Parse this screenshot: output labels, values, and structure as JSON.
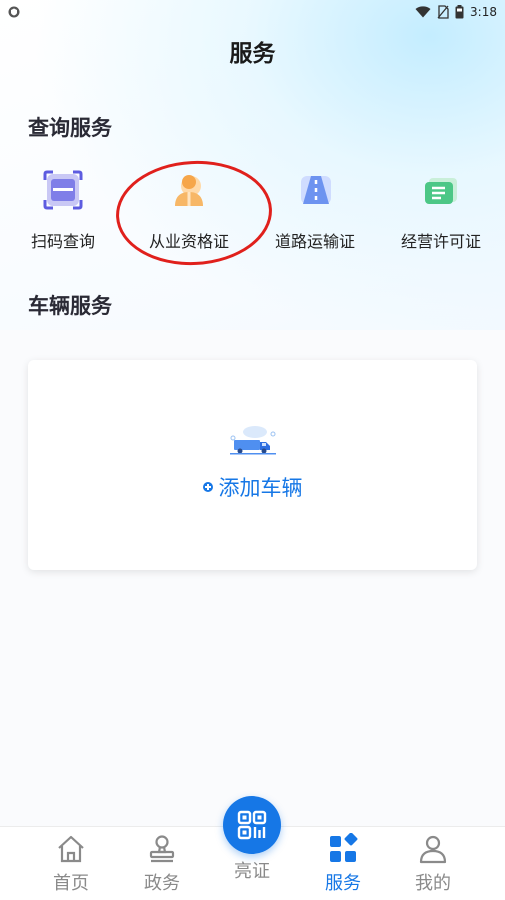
{
  "status_bar": {
    "time": "3:18",
    "icons": [
      "app-shield-icon",
      "wifi-icon",
      "no-sim-icon",
      "battery-icon"
    ]
  },
  "page_title": "服务",
  "query_section": {
    "title": "查询服务",
    "items": [
      {
        "label": "扫码查询",
        "icon": "scan-icon"
      },
      {
        "label": "从业资格证",
        "icon": "person-icon"
      },
      {
        "label": "道路运输证",
        "icon": "road-icon"
      },
      {
        "label": "经营许可证",
        "icon": "license-icon"
      }
    ]
  },
  "vehicle_section": {
    "title": "车辆服务",
    "add_label": "添加车辆"
  },
  "bottom_nav": {
    "items": [
      {
        "label": "首页",
        "icon": "home-icon"
      },
      {
        "label": "政务",
        "icon": "stamp-icon"
      },
      {
        "label": "亮证",
        "icon": "qr-code-icon"
      },
      {
        "label": "服务",
        "icon": "services-grid-icon",
        "active": true
      },
      {
        "label": "我的",
        "icon": "user-icon"
      }
    ]
  },
  "colors": {
    "accent": "#1677e6",
    "highlight": "#e0201c",
    "inactive": "#8a8a8a"
  }
}
